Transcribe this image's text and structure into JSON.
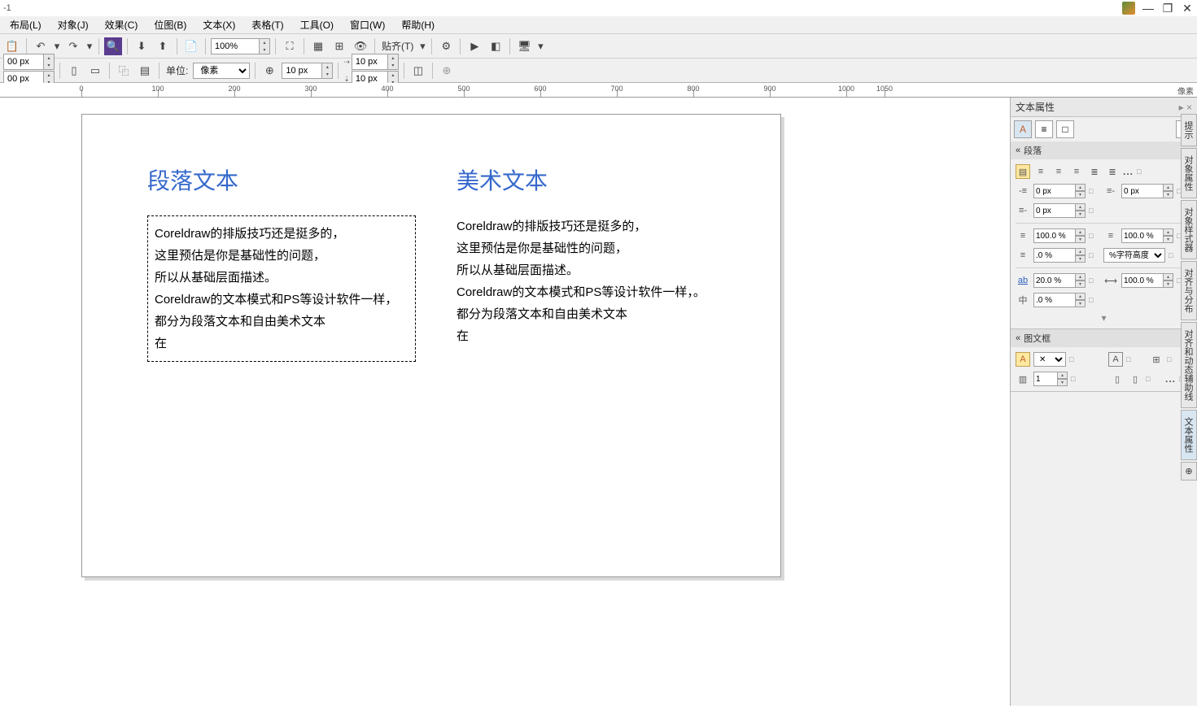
{
  "title": "-1",
  "menus": [
    "布局(L)",
    "对象(J)",
    "效果(C)",
    "位图(B)",
    "文本(X)",
    "表格(T)",
    "工具(O)",
    "窗口(W)",
    "帮助(H)"
  ],
  "toolbar1": {
    "zoom": "100%",
    "snap": "贴齐(T)"
  },
  "toolbar2": {
    "x": "00 px",
    "y": "00 px",
    "unit_label": "单位:",
    "unit": "像素",
    "nudge1": "10 px",
    "nudge2": "10 px",
    "nudge3": "10 px"
  },
  "ruler": {
    "unit": "像素",
    "ticks": [
      0,
      100,
      200,
      300,
      400,
      500,
      600,
      700,
      800,
      900,
      1000,
      1050
    ]
  },
  "canvas": {
    "para_title": "段落文本",
    "art_title": "美术文本",
    "para_lines": [
      "Coreldraw的排版技巧还是挺多的，",
      "这里预估是你是基础性的问题，",
      "所以从基础层面描述。",
      "Coreldraw的文本模式和PS等设计软件一样，",
      "都分为段落文本和自由美术文本",
      "在"
    ],
    "art_lines": [
      "Coreldraw的排版技巧还是挺多的，",
      "这里预估是你是基础性的问题，",
      "所以从基础层面描述。",
      "Coreldraw的文本模式和PS等设计软件一样，。",
      "都分为段落文本和自由美术文本",
      "在"
    ]
  },
  "panel": {
    "title": "文本属性",
    "section_paragraph": "段落",
    "section_frame": "图文框",
    "indent_left": "0 px",
    "indent_right": "0 px",
    "indent_first": "0 px",
    "spacing_before": "100.0 %",
    "spacing_after": "100.0 %",
    "line_spacing": ".0 %",
    "line_unit": "%字符高度",
    "char_spacing": "20.0 %",
    "word_spacing": "100.0 %",
    "lang_spacing": ".0 %",
    "columns": "1"
  },
  "side_tabs": [
    "提示",
    "对象属性",
    "对象样式器",
    "对齐与分布",
    "对齐和动态辅助线",
    "文本属性"
  ]
}
